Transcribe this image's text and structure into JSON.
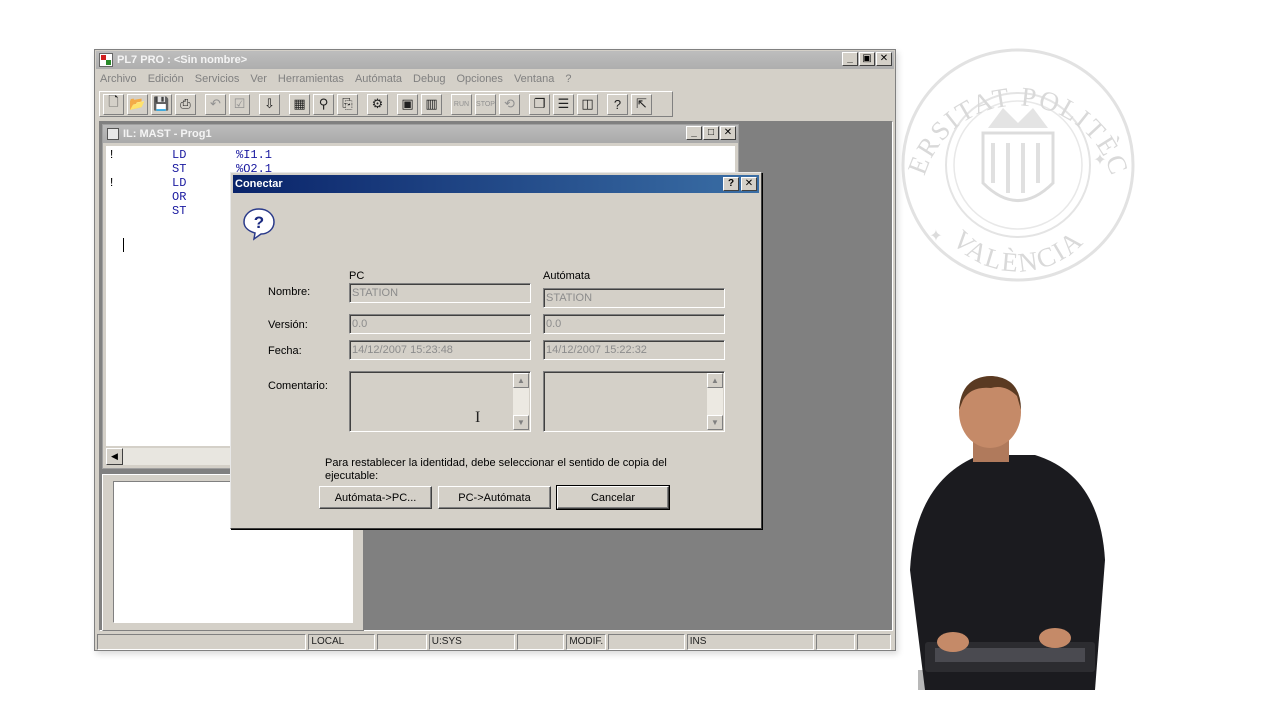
{
  "watermark": {
    "line1": "UNIVERSITAT POLITÈCNICA",
    "line2": "VALÈNCIA",
    "ring": "PROGRESSO"
  },
  "app": {
    "title": "PL7 PRO : <Sin nombre>",
    "menu": [
      "Archivo",
      "Edición",
      "Servicios",
      "Ver",
      "Herramientas",
      "Autómata",
      "Debug",
      "Opciones",
      "Ventana",
      "?"
    ],
    "window_buttons": [
      "_",
      "▣",
      "✕"
    ]
  },
  "toolbar": {
    "icons": [
      "new-icon",
      "open-icon",
      "save-icon",
      "print-icon",
      "undo-icon",
      "check-icon",
      "import-icon",
      "calculator-icon",
      "find-icon",
      "replace-icon",
      "io-config-icon",
      "monitor-icon",
      "memory-icon",
      "run-icon",
      "stop-icon",
      "init-icon",
      "cascade-icon",
      "tile-horizontal-icon",
      "tile-vertical-icon",
      "help-icon",
      "context-help-icon"
    ],
    "run_label": "RUN",
    "stop_label": "STOP"
  },
  "editor": {
    "title": "IL: MAST - Prog1",
    "lines": [
      {
        "marker": "!",
        "op": "LD",
        "arg": "%I1.1"
      },
      {
        "marker": "",
        "op": "ST",
        "arg": "%Q2.1"
      },
      {
        "marker": "!",
        "op": "LD",
        "arg": ""
      },
      {
        "marker": "",
        "op": "OR",
        "arg": ""
      },
      {
        "marker": "",
        "op": "ST",
        "arg": ""
      }
    ]
  },
  "statusbar": {
    "cells": [
      "",
      "LOCAL",
      "",
      "U:SYS",
      "",
      "MODIF.",
      "",
      "INS",
      "",
      ""
    ]
  },
  "dialog": {
    "title": "Conectar",
    "col_pc": "PC",
    "col_plc": "Autómata",
    "labels": {
      "name": "Nombre:",
      "version": "Versión:",
      "date": "Fecha:",
      "comment": "Comentario:"
    },
    "pc": {
      "name": "STATION",
      "version": "0.0",
      "date": "14/12/2007  15:23:48"
    },
    "plc": {
      "name": "STATION",
      "version": "0.0",
      "date": "14/12/2007  15:22:32"
    },
    "message": "Para restablecer la identidad, debe seleccionar el sentido de copia del ejecutable:",
    "buttons": {
      "plc_to_pc": "Autómata->PC...",
      "pc_to_plc": "PC->Autómata",
      "cancel": "Cancelar"
    }
  }
}
